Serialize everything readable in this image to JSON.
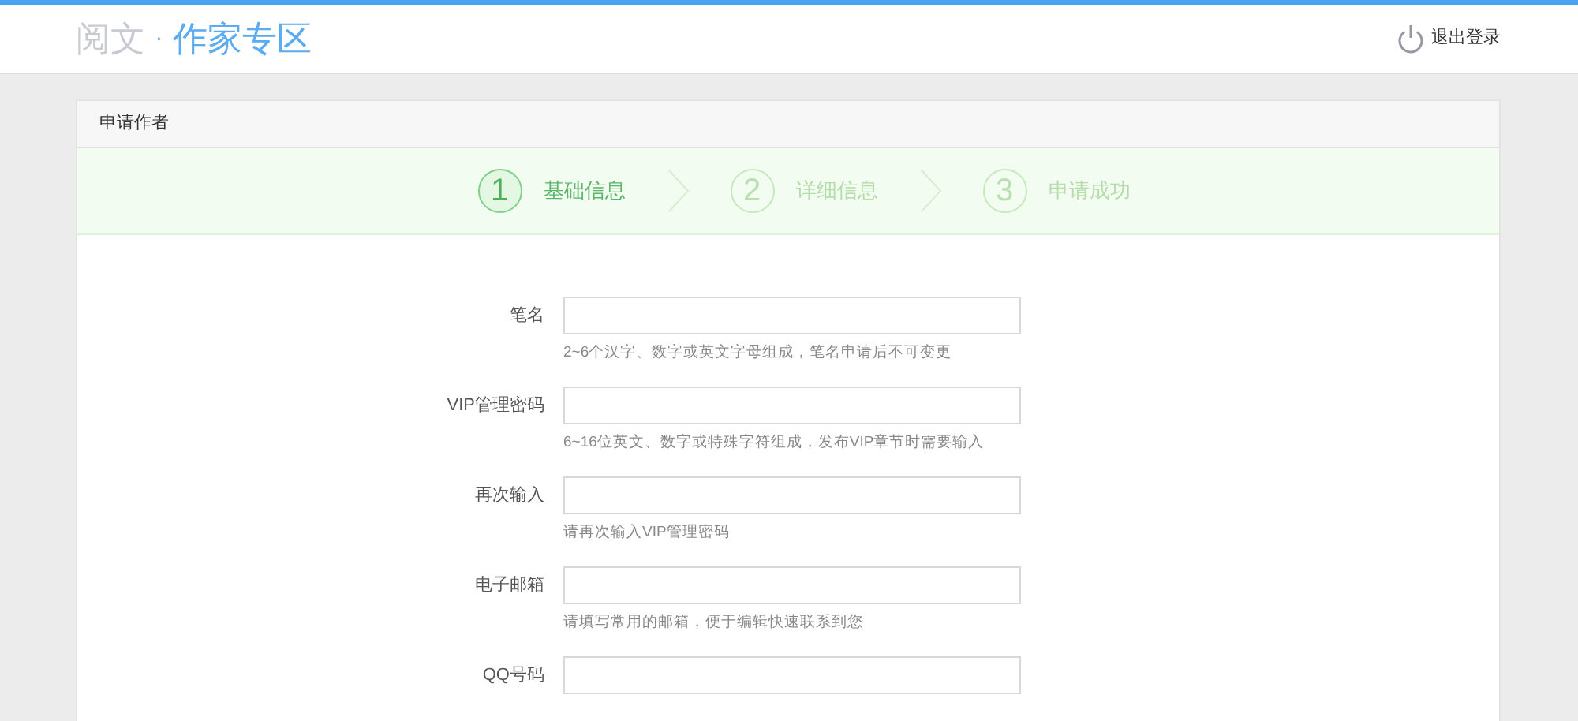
{
  "header": {
    "logo_brand": "阅文",
    "logo_separator": "·",
    "logo_title": "作家专区",
    "logout": "退出登录"
  },
  "card": {
    "title": "申请作者"
  },
  "steps": [
    {
      "number": "1",
      "label": "基础信息",
      "selected": true
    },
    {
      "number": "2",
      "label": "详细信息",
      "selected": false
    },
    {
      "number": "3",
      "label": "申请成功",
      "selected": false
    }
  ],
  "form": [
    {
      "label": "笔名",
      "hint": "2~6个汉字、数字或英文字母组成，笔名申请后不可变更"
    },
    {
      "label": "VIP管理密码",
      "hint": "6~16位英文、数字或特殊字符组成，发布VIP章节时需要输入"
    },
    {
      "label": "再次输入",
      "hint": "请再次输入VIP管理密码"
    },
    {
      "label": "电子邮箱",
      "hint": "请填写常用的邮箱，便于编辑快速联系到您"
    },
    {
      "label": "QQ号码"
    }
  ]
}
